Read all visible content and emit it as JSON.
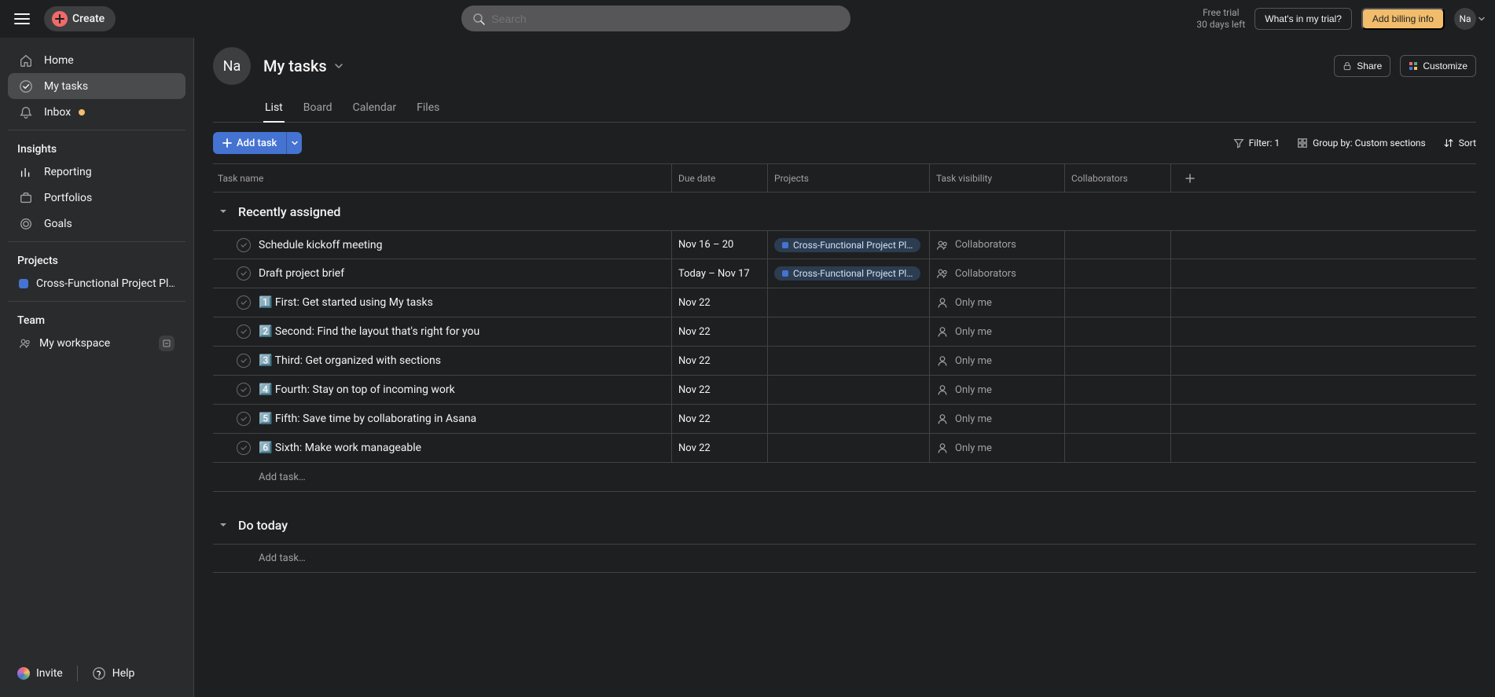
{
  "topbar": {
    "create": "Create",
    "search_placeholder": "Search",
    "trial_line1": "Free trial",
    "trial_line2": "30 days left",
    "whats_in_trial": "What's in my trial?",
    "billing": "Add billing info",
    "avatar": "Na"
  },
  "sidebar": {
    "home": "Home",
    "my_tasks": "My tasks",
    "inbox": "Inbox",
    "insights_header": "Insights",
    "reporting": "Reporting",
    "portfolios": "Portfolios",
    "goals": "Goals",
    "projects_header": "Projects",
    "project1": "Cross-Functional Project Pl…",
    "team_header": "Team",
    "workspace": "My workspace",
    "invite": "Invite",
    "help": "Help"
  },
  "page": {
    "avatar": "Na",
    "title": "My tasks",
    "share": "Share",
    "customize": "Customize",
    "tabs": {
      "list": "List",
      "board": "Board",
      "calendar": "Calendar",
      "files": "Files"
    }
  },
  "toolbar": {
    "add_task": "Add task",
    "filter": "Filter: 1",
    "group": "Group by: Custom sections",
    "sort": "Sort"
  },
  "columns": {
    "name": "Task name",
    "due": "Due date",
    "projects": "Projects",
    "visibility": "Task visibility",
    "collaborators": "Collaborators"
  },
  "project_pill": "Cross-Functional Project Pl…",
  "visibility": {
    "collaborators": "Collaborators",
    "only_me": "Only me"
  },
  "sections": {
    "recently": "Recently assigned",
    "do_today": "Do today"
  },
  "add_task_row": "Add task…",
  "tasks": [
    {
      "name": "Schedule kickoff meeting",
      "due": "Nov 16 – 20",
      "proj": true,
      "vis": "collaborators"
    },
    {
      "name": "Draft project brief",
      "due": "Today – Nov 17",
      "proj": true,
      "vis": "collaborators"
    },
    {
      "name": "1️⃣ First: Get started using My tasks",
      "due": "Nov 22",
      "proj": false,
      "vis": "only_me"
    },
    {
      "name": "2️⃣ Second: Find the layout that's right for you",
      "due": "Nov 22",
      "proj": false,
      "vis": "only_me"
    },
    {
      "name": "3️⃣ Third: Get organized with sections",
      "due": "Nov 22",
      "proj": false,
      "vis": "only_me"
    },
    {
      "name": "4️⃣ Fourth: Stay on top of incoming work",
      "due": "Nov 22",
      "proj": false,
      "vis": "only_me"
    },
    {
      "name": "5️⃣ Fifth: Save time by collaborating in Asana",
      "due": "Nov 22",
      "proj": false,
      "vis": "only_me"
    },
    {
      "name": "6️⃣ Sixth: Make work manageable",
      "due": "Nov 22",
      "proj": false,
      "vis": "only_me"
    }
  ]
}
